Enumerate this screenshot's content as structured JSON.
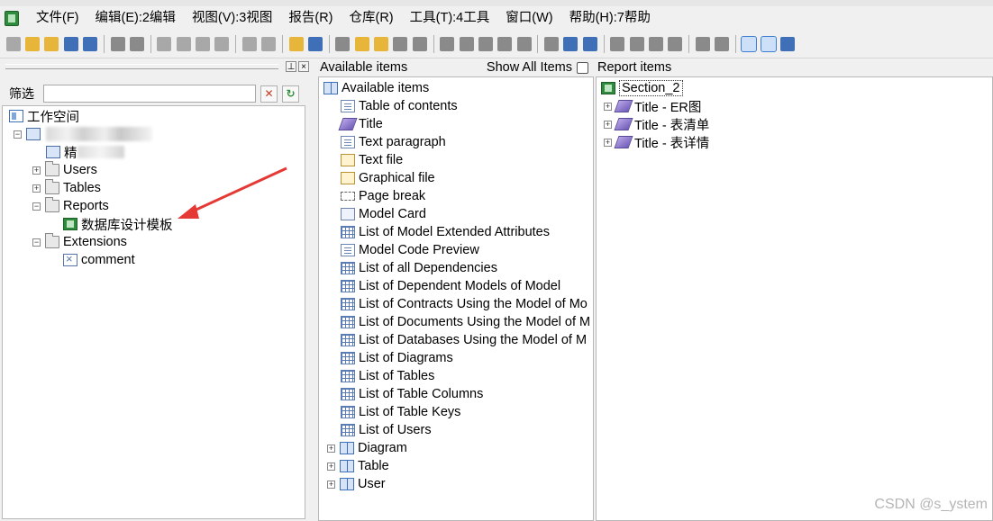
{
  "menu": {
    "items": [
      "文件(F)",
      "编辑(E):2编辑",
      "视图(V):3视图",
      "报告(R)",
      "仓库(R)",
      "工具(T):4工具",
      "窗口(W)",
      "帮助(H):7帮助"
    ]
  },
  "left": {
    "filter_label": "筛选",
    "filter_value": "",
    "tree": {
      "workspace": "工作空间",
      "model_sub": "精",
      "users": "Users",
      "tables": "Tables",
      "reports": "Reports",
      "report_item": "数据库设计模板",
      "extensions": "Extensions",
      "ext_item": "comment"
    }
  },
  "available": {
    "title": "Available items",
    "show_all": "Show All Items",
    "root": "Available items",
    "items": [
      "Table of contents",
      "Title",
      "Text paragraph",
      "Text file",
      "Graphical file",
      "Page break",
      "Model Card",
      "List of Model Extended Attributes",
      "Model Code Preview",
      "List of all Dependencies",
      "List of Dependent Models of Model",
      "List of Contracts Using the Model of Mo",
      "List of Documents Using the Model of M",
      "List of Databases Using the Model of M",
      "List of Diagrams",
      "List of Tables",
      "List of Table Columns",
      "List of Table Keys",
      "List of Users"
    ],
    "groups": [
      "Diagram",
      "Table",
      "User"
    ]
  },
  "report": {
    "title": "Report items",
    "section": "Section_2",
    "items": [
      "Title - ER图",
      "Title - 表清单",
      "Title - 表详情"
    ]
  },
  "watermark": "CSDN @s_ystem",
  "colors": {
    "accent": "#3e6fb7",
    "arrow": "#e53935",
    "report_icon": "#2e8b3d"
  }
}
